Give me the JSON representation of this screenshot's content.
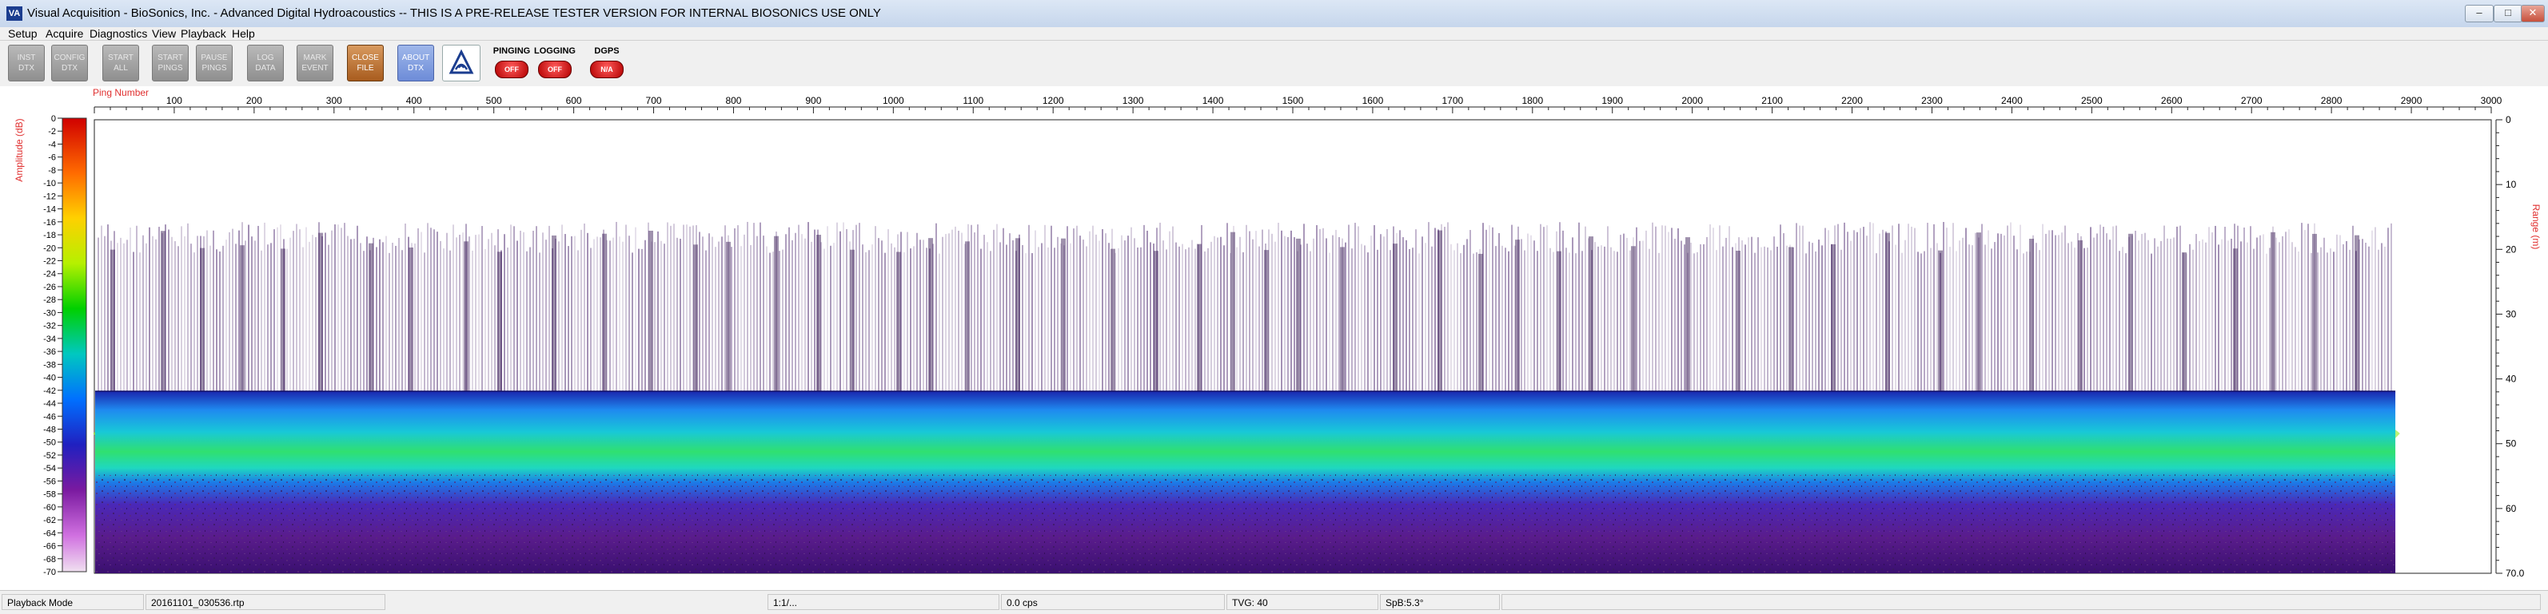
{
  "window": {
    "title": "Visual Acquisition  -  BioSonics, Inc.  -  Advanced Digital Hydroacoustics  --  THIS IS A PRE-RELEASE TESTER VERSION FOR INTERNAL BIOSONICS USE ONLY",
    "app_icon_text": "VA",
    "minimize": "–",
    "maximize": "□",
    "close": "✕"
  },
  "menu": [
    "Setup",
    "Acquire",
    "Diagnostics",
    "View",
    "Playback",
    "Help"
  ],
  "toolbar": {
    "inst_dtx": "INST DTX",
    "config_dtx": "CONFIG DTX",
    "start_all": "START ALL",
    "start_pings": "START PINGS",
    "pause_pings": "PAUSE PINGS",
    "log_data": "LOG DATA",
    "mark_event": "MARK EVENT",
    "close_file": "CLOSE FILE",
    "about_dtx": "ABOUT DTX",
    "pinging_label": "PINGING",
    "pinging_state": "OFF",
    "logging_label": "LOGGING",
    "logging_state": "OFF",
    "dgps_label": "DGPS",
    "dgps_state": "N/A"
  },
  "echogram": {
    "x_axis_title": "Ping Number",
    "x_ticks": [
      100,
      200,
      300,
      400,
      500,
      600,
      700,
      800,
      900,
      1000,
      1100,
      1200,
      1300,
      1400,
      1500,
      1600,
      1700,
      1800,
      1900,
      2000,
      2100,
      2200,
      2300,
      2400,
      2500,
      2600,
      2700,
      2800,
      2900,
      3000
    ],
    "x_range": [
      0,
      3000
    ],
    "y_axis_title_right": "Range (m)",
    "y_ticks_right": [
      "0",
      "10",
      "20",
      "30",
      "40",
      "50",
      "60",
      "70.0"
    ],
    "y_range": [
      0,
      70
    ],
    "color_scale_title": "Amplitude (dB)",
    "color_scale_ticks": [
      "0",
      "-2",
      "-4",
      "-6",
      "-8",
      "-10",
      "-12",
      "-14",
      "-16",
      "-18",
      "-20",
      "-22",
      "-24",
      "-26",
      "-28",
      "-30",
      "-32",
      "-34",
      "-36",
      "-38",
      "-40",
      "-42",
      "-44",
      "-46",
      "-48",
      "-50",
      "-52",
      "-54",
      "-56",
      "-58",
      "-60",
      "-62",
      "-64",
      "-66",
      "-68",
      "-70"
    ],
    "data_extent_ping": 2880,
    "bottom_depth_m": 42
  },
  "statusbar": {
    "mode": "Playback Mode",
    "file": "20161101_030536.rtp",
    "ratio": "1:1/...",
    "rate": "0.0 cps",
    "tvg": "TVG: 40",
    "spb": "SpB:5.3°",
    "dot": "."
  },
  "colors": {
    "axis_red": "#e03030",
    "titlebar": "#c6d6ec",
    "panel": "#f0f0f0"
  }
}
